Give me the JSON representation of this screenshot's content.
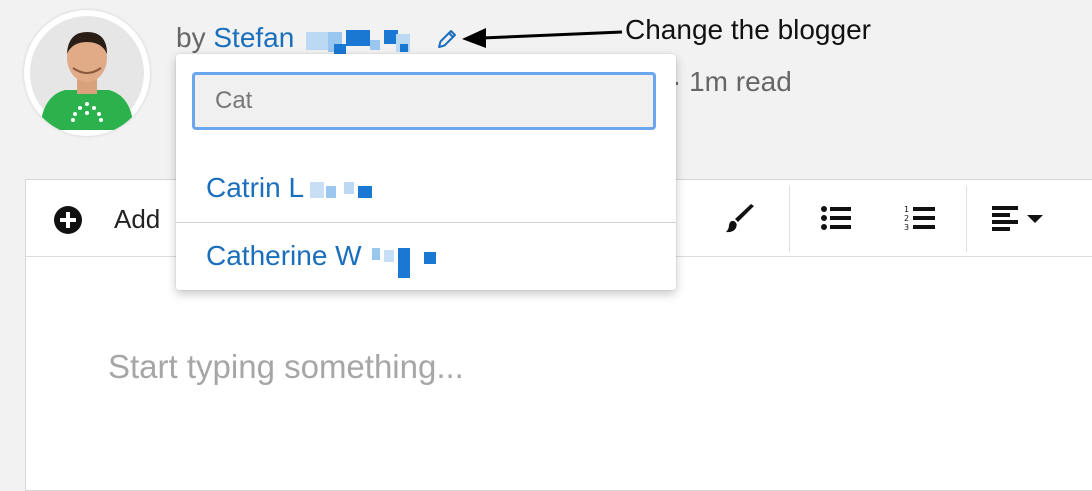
{
  "byline": {
    "prefix": "by",
    "author": "Stefan"
  },
  "annotation": {
    "text": "Change the blogger"
  },
  "meta": {
    "read_time": "· 1m read"
  },
  "author_picker": {
    "query": "Cat",
    "options": [
      {
        "label": "Catrin L"
      },
      {
        "label": "Catherine W"
      }
    ]
  },
  "toolbar": {
    "add_label": "Add"
  },
  "editor": {
    "placeholder": "Start typing something..."
  },
  "colors": {
    "link": "#1a6fbd",
    "focus_ring": "#6aa6ee",
    "redaction": "#1a78d2"
  }
}
